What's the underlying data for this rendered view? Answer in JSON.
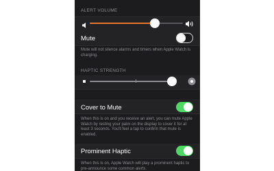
{
  "alert_volume": {
    "header": "ALERT VOLUME",
    "level": 0.72,
    "fill_color": "#e8762b",
    "min_icon": "speaker-low-icon",
    "max_icon": "speaker-high-icon"
  },
  "mute": {
    "label": "Mute",
    "on": false,
    "footnote": "Mute will not silence alarms and timers when Apple Watch is charging."
  },
  "haptic_strength": {
    "header": "HAPTIC STRENGTH",
    "level": 0.9,
    "min_icon": "haptic-low-icon",
    "max_icon": "haptic-high-icon"
  },
  "cover_to_mute": {
    "label": "Cover to Mute",
    "on": true,
    "footnote": "When this is on and you receive an alert, you can mute Apple Watch by resting your palm on the display to cover it for at least 3 seconds. You'll feel a tap to confirm that mute is enabled."
  },
  "prominent_haptic": {
    "label": "Prominent Haptic",
    "on": true,
    "footnote": "When this is on, Apple Watch will play a prominent haptic to pre-announce some common alerts."
  },
  "colors": {
    "toggle_on": "#4cd964",
    "background": "#1c1c1e",
    "accent": "#e8762b"
  }
}
